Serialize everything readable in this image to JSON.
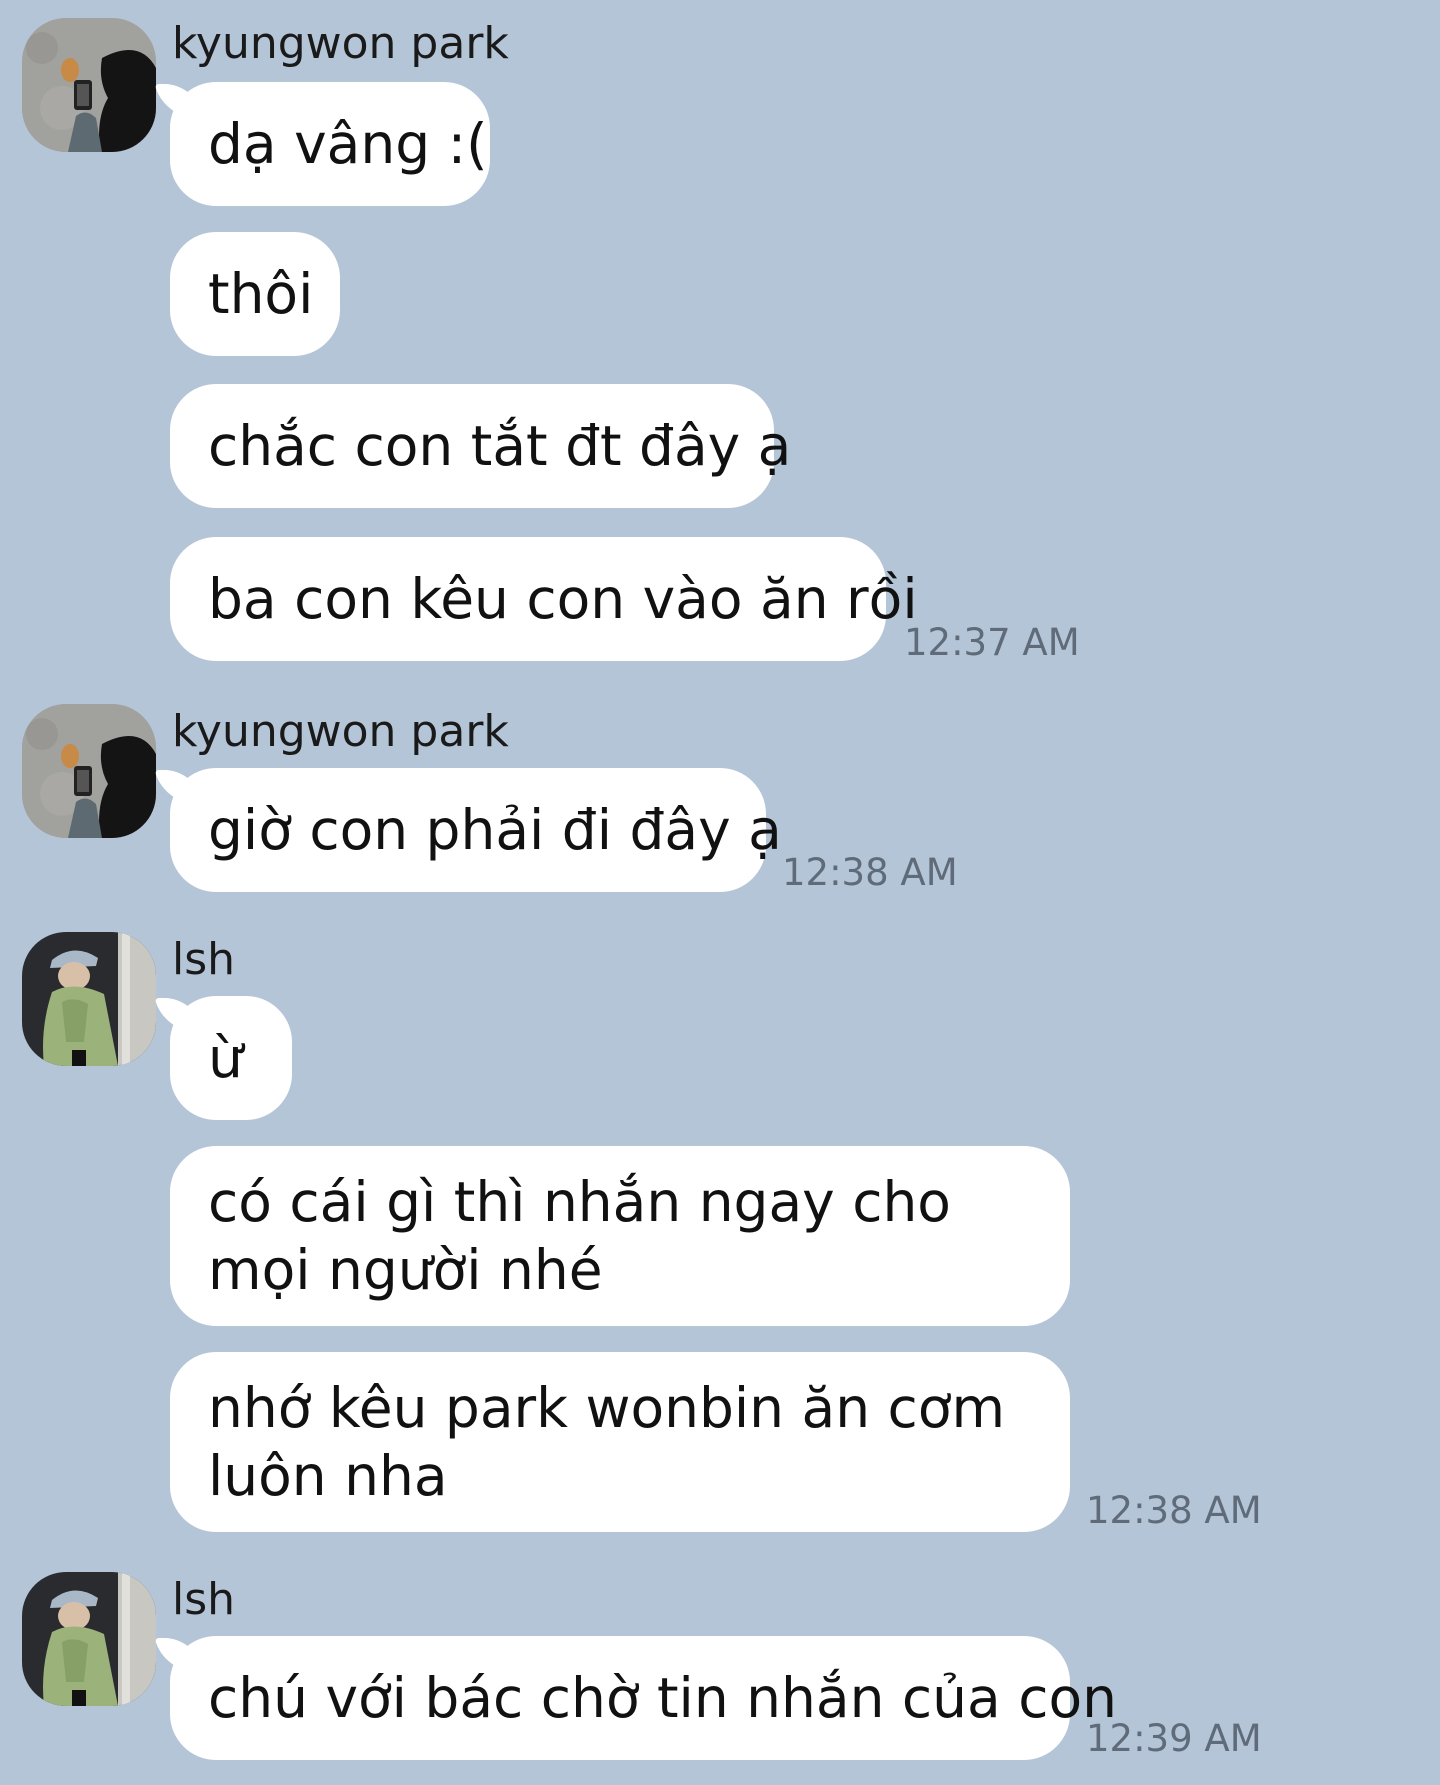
{
  "groups": [
    {
      "sender": "kyungwon park",
      "avatar_icon": "profile-photo-girl-with-phone",
      "messages": [
        "dạ vâng :(",
        "thôi",
        "chắc con tắt đt đây ạ",
        "ba con kêu con vào ăn rồi"
      ],
      "time": "12:37 AM"
    },
    {
      "sender": "kyungwon park",
      "avatar_icon": "profile-photo-girl-with-phone",
      "messages": [
        "giờ con phải đi đây ạ"
      ],
      "time": "12:38 AM"
    },
    {
      "sender": "lsh",
      "avatar_icon": "profile-photo-boy-in-cap",
      "messages": [
        "ừ",
        "có cái gì thì nhắn ngay cho mọi người nhé",
        "nhớ kêu park wonbin ăn cơm luôn nha"
      ],
      "time": "12:38 AM"
    },
    {
      "sender": "lsh",
      "avatar_icon": "profile-photo-boy-in-cap",
      "messages": [
        "chú với bác chờ tin nhắn của con"
      ],
      "time": "12:39 AM"
    }
  ]
}
